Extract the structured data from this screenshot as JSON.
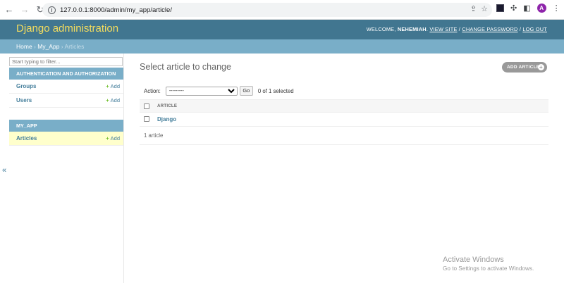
{
  "browser": {
    "url": "127.0.0.1:8000/admin/my_app/article/",
    "avatar_letter": "A"
  },
  "header": {
    "branding": "Django administration",
    "welcome": "WELCOME,",
    "username": "NEHEMIAH",
    "view_site": "VIEW SITE",
    "change_password": "CHANGE PASSWORD",
    "log_out": "LOG OUT"
  },
  "breadcrumbs": {
    "home": "Home",
    "app": "My_App",
    "current": "Articles"
  },
  "sidebar": {
    "filter_placeholder": "Start typing to filter...",
    "modules": [
      {
        "caption": "AUTHENTICATION AND AUTHORIZATION",
        "models": [
          {
            "name": "Groups",
            "add": "Add"
          },
          {
            "name": "Users",
            "add": "Add"
          }
        ]
      },
      {
        "caption": "MY_APP",
        "models": [
          {
            "name": "Articles",
            "add": "Add"
          }
        ]
      }
    ],
    "collapse_glyph": "«"
  },
  "content": {
    "title": "Select article to change",
    "add_button": "ADD ARTICLE",
    "action_label": "Action:",
    "action_selected": "---------",
    "go_label": "Go",
    "selection_count": "0 of 1 selected",
    "column_header": "ARTICLE",
    "rows": [
      "Django"
    ],
    "paginator": "1 article"
  },
  "watermark": {
    "title": "Activate Windows",
    "subtitle": "Go to Settings to activate Windows."
  },
  "colors": {
    "header_bg": "#417690",
    "branding": "#f5dd5d",
    "breadcrumbs_bg": "#79aec8",
    "link": "#447e9b",
    "add_green": "#70bf2b",
    "current_row": "#ffffcc"
  }
}
